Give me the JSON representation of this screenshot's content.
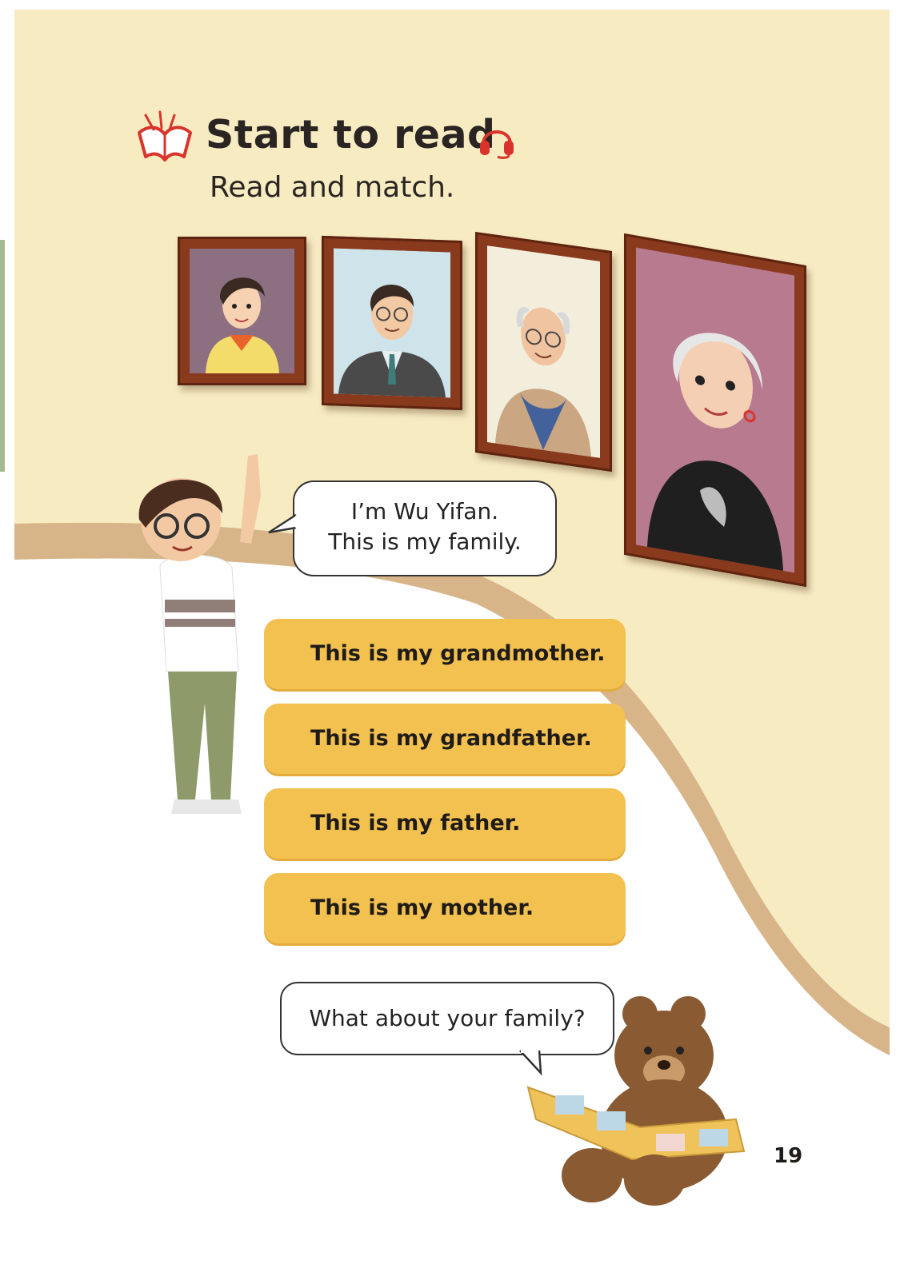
{
  "section": {
    "title": "Start to read",
    "instruction": "Read and match.",
    "icon": "open-book-icon",
    "audio_icon": "headphones-icon"
  },
  "portraits": [
    {
      "name": "mother"
    },
    {
      "name": "father"
    },
    {
      "name": "grandfather"
    },
    {
      "name": "grandmother"
    }
  ],
  "boy_bubble": {
    "line1": "I’m Wu Yifan.",
    "line2": "This is my family."
  },
  "sentences": [
    "This is my grandmother.",
    "This is my grandfather.",
    "This is my father.",
    "This is my mother."
  ],
  "bear_bubble": {
    "text": "What about your family?"
  },
  "page_number": "19",
  "colors": {
    "wall": "#f7ebc2",
    "floor_band": "#d7b588",
    "sentence_box": "#f3c150",
    "frame": "#8a3a1c",
    "accent_red": "#d9342b"
  }
}
